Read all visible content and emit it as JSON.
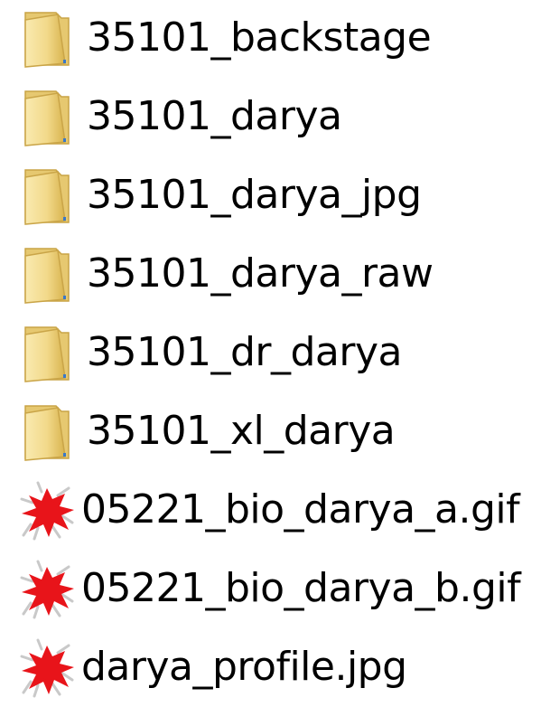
{
  "files": [
    {
      "name": "35101_backstage",
      "icon": "folder-icon"
    },
    {
      "name": "35101_darya",
      "icon": "folder-icon"
    },
    {
      "name": "35101_darya_jpg",
      "icon": "folder-icon"
    },
    {
      "name": "35101_darya_raw",
      "icon": "folder-icon"
    },
    {
      "name": "35101_dr_darya",
      "icon": "folder-icon"
    },
    {
      "name": "35101_xl_darya",
      "icon": "folder-icon"
    },
    {
      "name": "05221_bio_darya_a.gif",
      "icon": "image-file-icon"
    },
    {
      "name": "05221_bio_darya_b.gif",
      "icon": "image-file-icon"
    },
    {
      "name": "darya_profile.jpg",
      "icon": "image-file-icon"
    }
  ],
  "colors": {
    "folder_light": "#f7e7a5",
    "folder_dark": "#d9b54e",
    "image_icon_red": "#e8141a"
  }
}
